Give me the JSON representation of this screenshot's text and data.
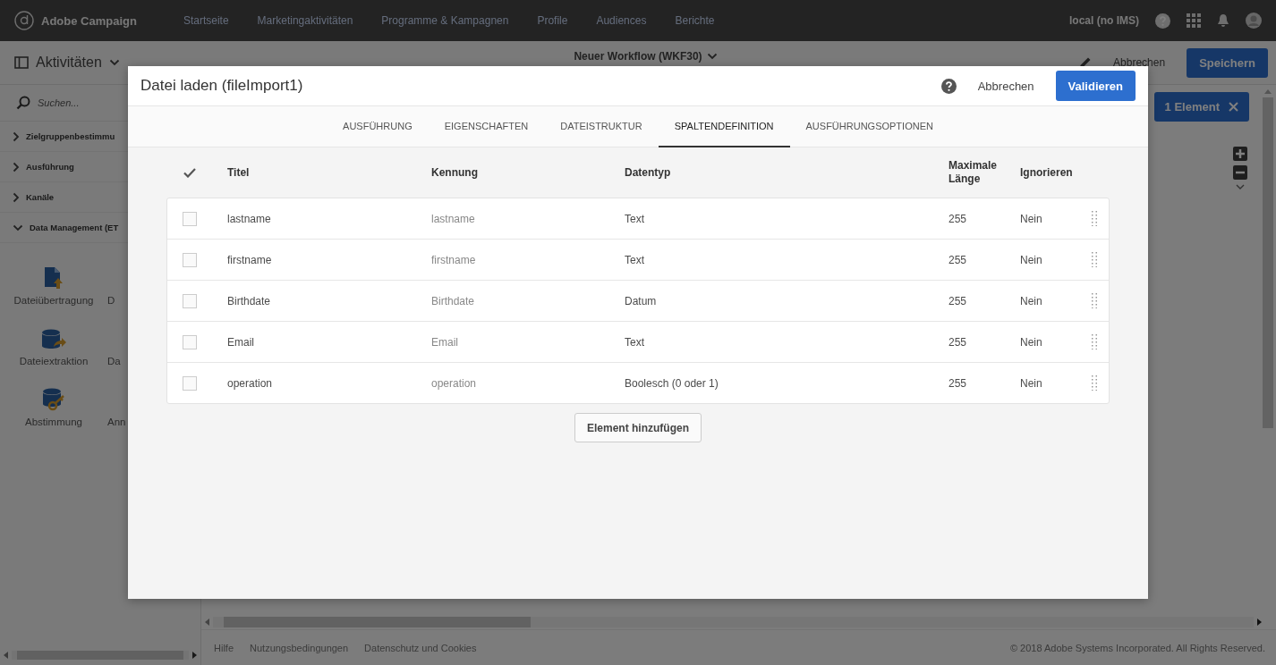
{
  "app": {
    "logo_text": "Adobe Campaign",
    "nav": [
      "Startseite",
      "Marketingaktivitäten",
      "Programme & Kampagnen",
      "Profile",
      "Audiences",
      "Berichte"
    ],
    "user": "local (no IMS)"
  },
  "toolbar": {
    "panel_title": "Aktivitäten",
    "workflow_title": "Neuer Workflow (WKF30)",
    "cancel": "Abbrechen",
    "save": "Speichern"
  },
  "sidebar": {
    "search_placeholder": "Suchen...",
    "sections": [
      {
        "label": "Zielgruppenbestimmu",
        "expanded": false
      },
      {
        "label": "Ausführung",
        "expanded": false
      },
      {
        "label": "Kanäle",
        "expanded": false
      },
      {
        "label": "Data Management (ET",
        "expanded": true
      }
    ],
    "activities": [
      {
        "label": "Dateiübertragung",
        "kind": "transfer"
      },
      {
        "label": "D",
        "kind": "partial"
      },
      {
        "label": "Dateiextraktion",
        "kind": "extraction"
      },
      {
        "label": "Da",
        "kind": "partial"
      },
      {
        "label": "Abstimmung",
        "kind": "reconciliation"
      },
      {
        "label": "Ann",
        "kind": "partial"
      }
    ]
  },
  "selection_badge": "1 Element",
  "footer": {
    "links": [
      "Hilfe",
      "Nutzungsbedingungen",
      "Datenschutz und Cookies"
    ],
    "copyright": "© 2018 Adobe Systems Incorporated. All Rights Reserved."
  },
  "dialog": {
    "title": "Datei laden (fileImport1)",
    "cancel": "Abbrechen",
    "validate": "Validieren",
    "tabs": [
      {
        "label": "AUSFÜHRUNG",
        "selected": false
      },
      {
        "label": "EIGENSCHAFTEN",
        "selected": false
      },
      {
        "label": "DATEISTRUKTUR",
        "selected": false
      },
      {
        "label": "SPALTENDEFINITION",
        "selected": true
      },
      {
        "label": "AUSFÜHRUNGSOPTIONEN",
        "selected": false
      }
    ],
    "columns": [
      "Titel",
      "Kennung",
      "Datentyp",
      "Maximale Länge",
      "Ignorieren"
    ],
    "rows": [
      {
        "checked": false,
        "title": "lastname",
        "id": "lastname",
        "type": "Text",
        "max_length": "255",
        "ignore": "Nein"
      },
      {
        "checked": false,
        "title": "firstname",
        "id": "firstname",
        "type": "Text",
        "max_length": "255",
        "ignore": "Nein"
      },
      {
        "checked": false,
        "title": "Birthdate",
        "id": "Birthdate",
        "type": "Datum",
        "max_length": "255",
        "ignore": "Nein"
      },
      {
        "checked": false,
        "title": "Email",
        "id": "Email",
        "type": "Text",
        "max_length": "255",
        "ignore": "Nein"
      },
      {
        "checked": false,
        "title": "operation",
        "id": "operation",
        "type": "Boolesch (0 oder 1)",
        "max_length": "255",
        "ignore": "Nein"
      }
    ],
    "add_button": "Element hinzufügen"
  }
}
